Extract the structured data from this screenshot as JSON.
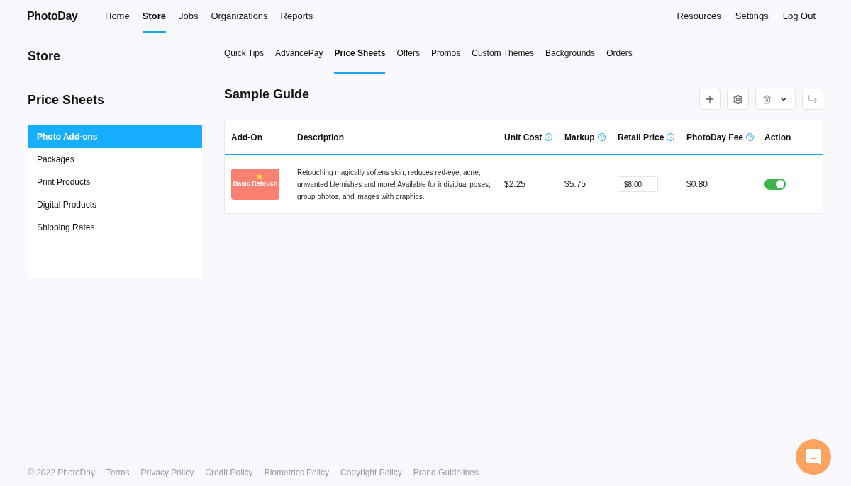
{
  "logo": "PhotoDay",
  "main_nav": [
    {
      "label": "Home",
      "selected": false
    },
    {
      "label": "Store",
      "selected": true
    },
    {
      "label": "Jobs",
      "selected": false
    },
    {
      "label": "Organizations",
      "selected": false
    },
    {
      "label": "Reports",
      "selected": false
    }
  ],
  "user_nav": [
    "Resources",
    "Settings",
    "Log Out"
  ],
  "page_title": "Store",
  "sub_tabs": [
    {
      "label": "Quick Tips",
      "selected": false
    },
    {
      "label": "AdvancePay",
      "selected": false
    },
    {
      "label": "Price Sheets",
      "selected": true
    },
    {
      "label": "Offers",
      "selected": false
    },
    {
      "label": "Promos",
      "selected": false
    },
    {
      "label": "Custom Themes",
      "selected": false
    },
    {
      "label": "Backgrounds",
      "selected": false
    },
    {
      "label": "Orders",
      "selected": false
    }
  ],
  "sidebar": {
    "title": "Price Sheets",
    "items": [
      {
        "label": "Photo Add-ons",
        "selected": true
      },
      {
        "label": "Packages",
        "selected": false
      },
      {
        "label": "Print Products",
        "selected": false
      },
      {
        "label": "Digital Products",
        "selected": false
      },
      {
        "label": "Shipping Rates",
        "selected": false
      }
    ]
  },
  "sheet_title": "Sample Guide",
  "table": {
    "columns": [
      {
        "label": "Add-On",
        "help": false
      },
      {
        "label": "Description",
        "help": false
      },
      {
        "label": "Unit Cost",
        "help": true
      },
      {
        "label": "Markup",
        "help": true
      },
      {
        "label": "Retail Price",
        "help": true
      },
      {
        "label": "PhotoDay Fee",
        "help": true
      },
      {
        "label": "Action",
        "help": false
      }
    ],
    "rows": [
      {
        "thumbnail": "Basic Retouch",
        "description": "Retouching magically softens skin, reduces red-eye, acne, unwanted blemishes and more! Available for individual poses, group photos, and images with graphics.",
        "unit_cost": "$2.25",
        "markup": "$5.75",
        "retail_price": "$8.00",
        "fee": "$0.80",
        "on": true
      }
    ]
  },
  "footer": [
    "© 2022 PhotoDay",
    "Terms",
    "Privacy Policy",
    "Credit Policy",
    "Biometrics Policy",
    "Copyright Policy",
    "Brand Guidelines"
  ]
}
